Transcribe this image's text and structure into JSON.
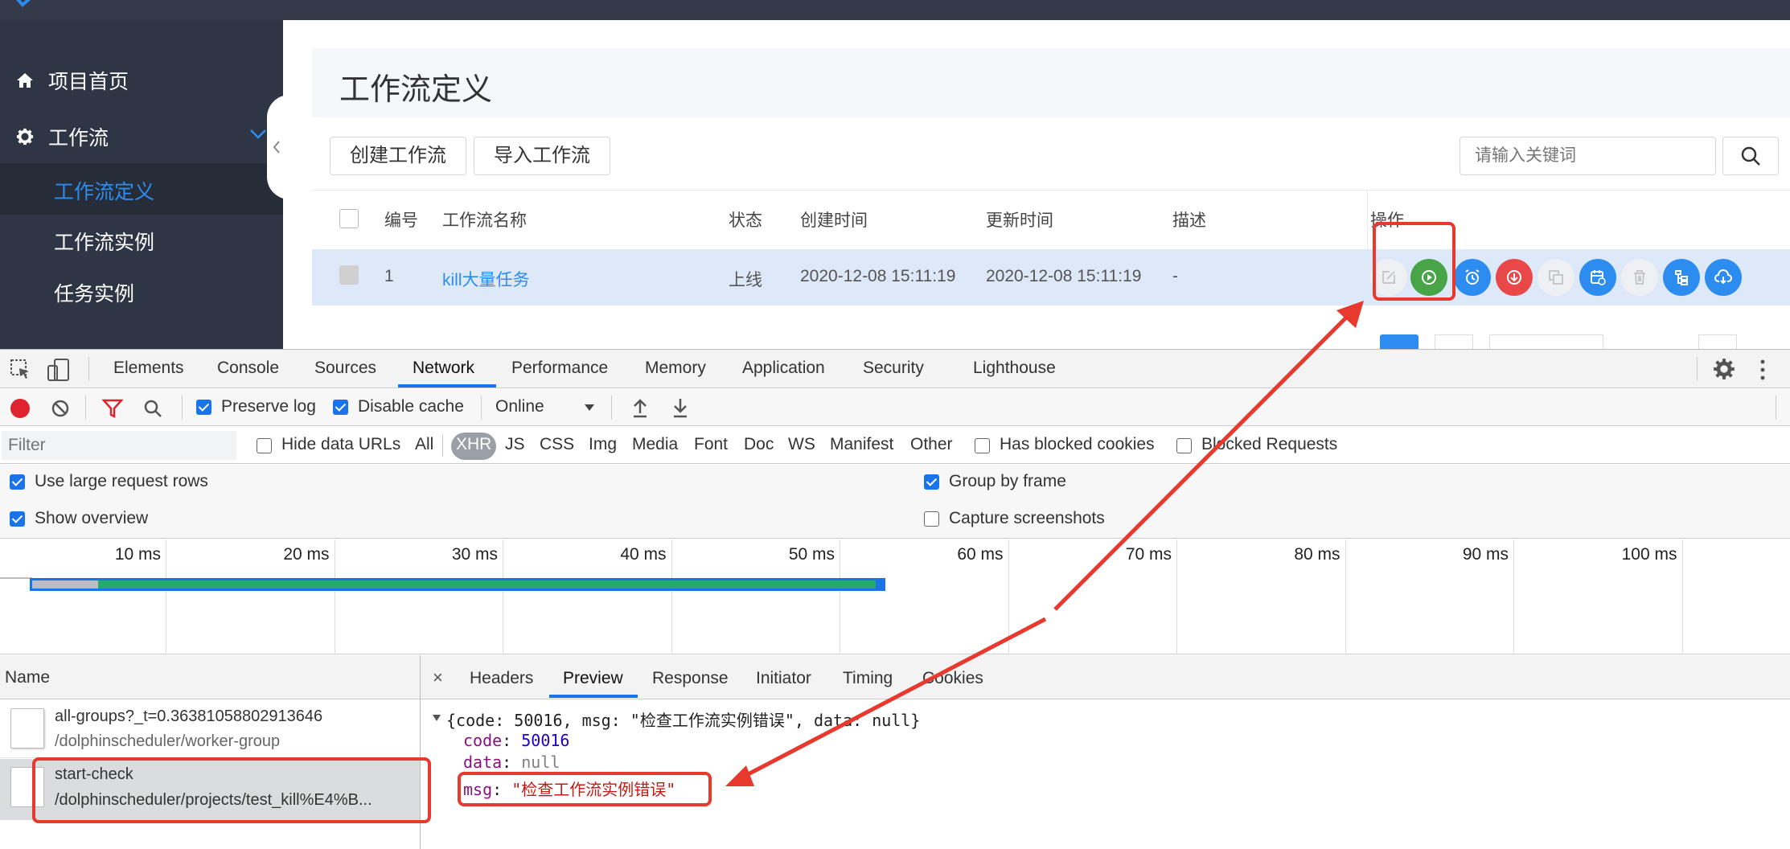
{
  "sidebar": {
    "items": [
      {
        "label": "项目首页",
        "icon": "home-icon"
      },
      {
        "label": "工作流",
        "icon": "gear-icon"
      },
      {
        "label": "工作流定义",
        "active": true
      },
      {
        "label": "工作流实例"
      },
      {
        "label": "任务实例"
      }
    ]
  },
  "main": {
    "title": "工作流定义",
    "create_button": "创建工作流",
    "import_button": "导入工作流",
    "search_placeholder": "请输入关键词",
    "table": {
      "headers": [
        "编号",
        "工作流名称",
        "状态",
        "创建时间",
        "更新时间",
        "描述",
        "操作"
      ],
      "rows": [
        {
          "id": "1",
          "name": "kill大量任务",
          "status": "上线",
          "created": "2020-12-08 15:11:19",
          "updated": "2020-12-08 15:11:19",
          "desc": "-"
        }
      ]
    },
    "colors": {
      "primary": "#2d8cf0",
      "success": "#47a447",
      "danger": "#e94848",
      "link": "#2d8cf0"
    }
  },
  "devtools": {
    "tabs": [
      "Elements",
      "Console",
      "Sources",
      "Network",
      "Performance",
      "Memory",
      "Application",
      "Security",
      "Lighthouse"
    ],
    "active_tab": "Network",
    "toolbar": {
      "preserve_log": "Preserve log",
      "disable_cache": "Disable cache",
      "throttle": "Online"
    },
    "filter": {
      "placeholder": "Filter",
      "hide_data_urls": "Hide data URLs",
      "types": [
        "All",
        "XHR",
        "JS",
        "CSS",
        "Img",
        "Media",
        "Font",
        "Doc",
        "WS",
        "Manifest",
        "Other"
      ],
      "active_type": "XHR",
      "has_blocked_cookies": "Has blocked cookies",
      "blocked_requests": "Blocked Requests"
    },
    "settings": {
      "large_rows": "Use large request rows",
      "show_overview": "Show overview",
      "group_by_frame": "Group by frame",
      "capture_screenshots": "Capture screenshots"
    },
    "timeline_ticks": [
      "10 ms",
      "20 ms",
      "30 ms",
      "40 ms",
      "50 ms",
      "60 ms",
      "70 ms",
      "80 ms",
      "90 ms",
      "100 ms"
    ],
    "requests_header": "Name",
    "requests": [
      {
        "name": "all-groups?_t=0.36381058802913646",
        "path": "/dolphinscheduler/worker-group"
      },
      {
        "name": "start-check",
        "path": "/dolphinscheduler/projects/test_kill%E4%B..."
      }
    ],
    "detail_tabs": [
      "Headers",
      "Preview",
      "Response",
      "Initiator",
      "Timing",
      "Cookies"
    ],
    "active_detail_tab": "Preview",
    "close_symbol": "×",
    "preview": {
      "summary": "{code: 50016, msg: \"检查工作流实例错误\", data: null}",
      "code_key": "code",
      "code_value": "50016",
      "data_key": "data",
      "data_value": "null",
      "msg_key": "msg",
      "msg_value": "\"检查工作流实例错误\""
    }
  },
  "annotation_color": "#e8392f"
}
